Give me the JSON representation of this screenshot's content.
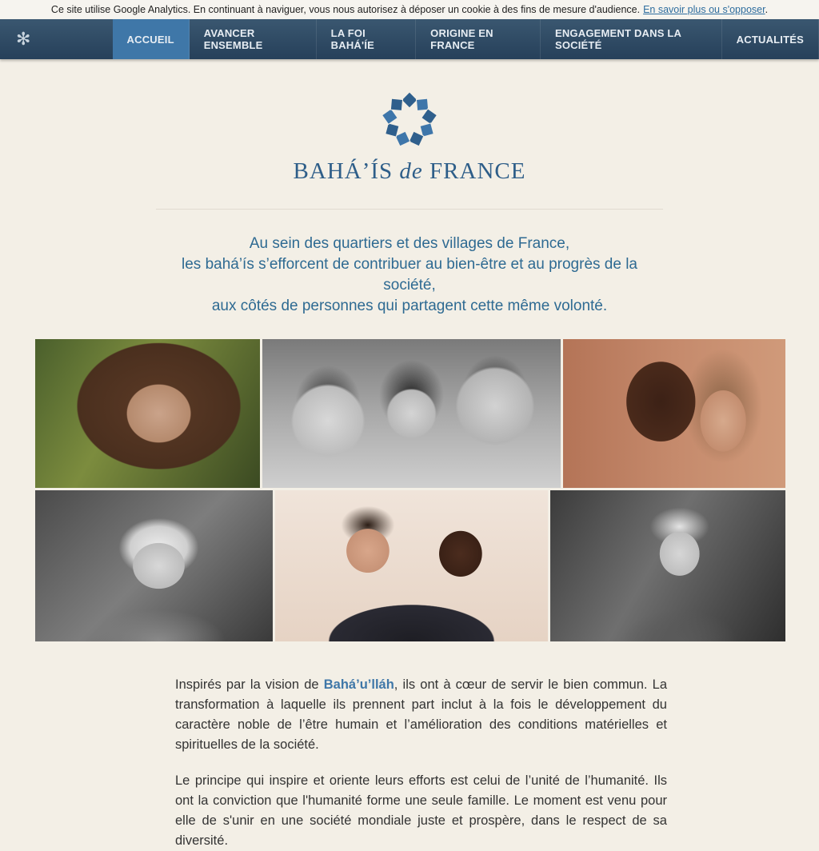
{
  "cookie_bar": {
    "text": "Ce site utilise Google Analytics. En continuant à naviguer, vous nous autorisez à déposer un cookie à des fins de mesure d'audience.",
    "link": "En savoir plus ou s'opposer",
    "end": "."
  },
  "nav": {
    "icon": "gear-icon",
    "items": [
      {
        "label": "ACCUEIL",
        "active": true
      },
      {
        "label": "AVANCER ENSEMBLE"
      },
      {
        "label": "LA FOI BAHÁ'ÍE"
      },
      {
        "label": "ORIGINE EN FRANCE"
      },
      {
        "label": "ENGAGEMENT DANS LA SOCIÉTÉ"
      },
      {
        "label": "ACTUALITÉS"
      }
    ]
  },
  "logo": {
    "part1": "BAHÁ’ÍS",
    "part2": "de",
    "part3": "FRANCE",
    "color": "#3e76aa"
  },
  "tagline": [
    "Au sein des quartiers et des villages de France,",
    "les bahá’ís s’efforcent de contribuer au bien-être et au progrès de la société,",
    "aux côtés de personnes qui partagent cette même volonté."
  ],
  "intro": {
    "p1_a": "Inspirés par la vision de ",
    "p1_link": "Bahá’u’lláh",
    "p1_b": ", ils ont à cœur de servir le bien commun. La transformation à laquelle ils prennent part inclut à la fois le développement du caractère noble de l’être humain et l’amélioration des conditions matérielles et spirituelles de la société.",
    "p2": "Le principe qui inspire et oriente leurs efforts est celui de l’unité de l’humanité. Ils ont la conviction que l'humanité forme une seule famille. Le moment est venu pour elle de s'unir en une société mondiale juste et prospère, dans le respect de sa diversité."
  }
}
